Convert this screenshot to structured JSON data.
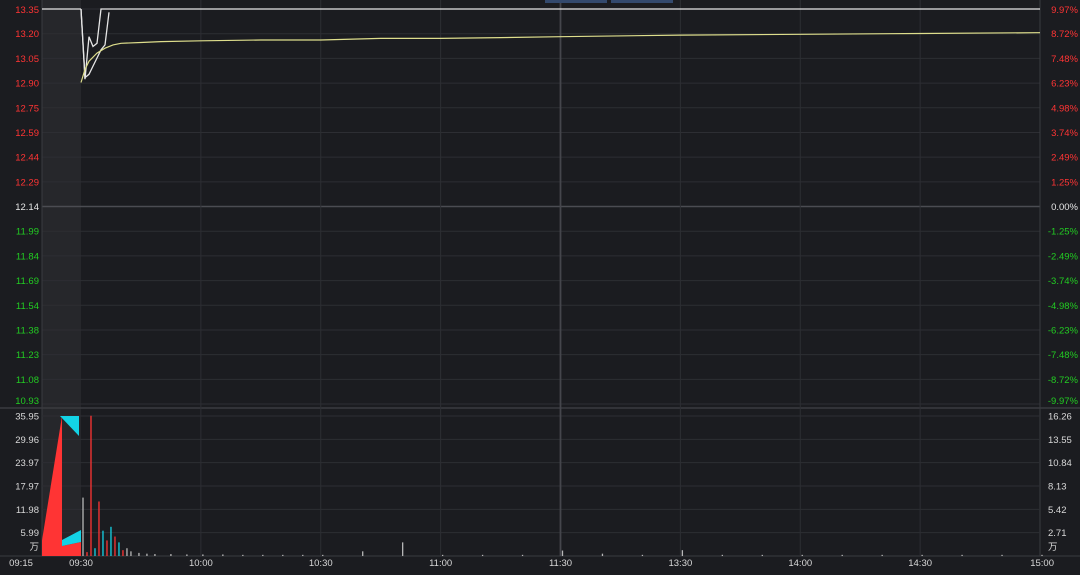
{
  "colors": {
    "background": "#1b1c20",
    "preopen_shade": "#26272b",
    "grid": "#2d2e33",
    "up": "#ff3434",
    "down": "#22cc22",
    "flat": "#e6e6e6",
    "price_line": "#e6e6e6",
    "avg_line": "#dede8c",
    "volume_neutral": "#b8b8b8",
    "auction_buy": "#ff3434",
    "auction_sell": "#13d3e6",
    "tab": "#33496d"
  },
  "price_axis": {
    "left_ticks": [
      "13.35",
      "13.20",
      "13.05",
      "12.90",
      "12.75",
      "12.59",
      "12.44",
      "12.29",
      "12.14",
      "11.99",
      "11.84",
      "11.69",
      "11.54",
      "11.38",
      "11.23",
      "11.08",
      "10.93"
    ],
    "right_ticks": [
      "9.97%",
      "8.72%",
      "7.48%",
      "6.23%",
      "4.98%",
      "3.74%",
      "2.49%",
      "1.25%",
      "0.00%",
      "-1.25%",
      "-2.49%",
      "-3.74%",
      "-4.98%",
      "-6.23%",
      "-7.48%",
      "-8.72%",
      "-9.97%"
    ],
    "prev_close": 12.14,
    "max": 13.35,
    "min": 10.93
  },
  "volume_axis": {
    "left_ticks": [
      "35.95",
      "29.96",
      "23.97",
      "17.97",
      "11.98",
      "5.99"
    ],
    "left_unit": "万",
    "right_ticks": [
      "16.26",
      "13.55",
      "10.84",
      "8.13",
      "5.42",
      "2.71"
    ],
    "right_unit": "万",
    "max": 35.95
  },
  "time_axis": {
    "labels": [
      "09:15",
      "09:30",
      "10:00",
      "10:30",
      "11:00",
      "11:30",
      "13:30",
      "14:00",
      "14:30",
      "15:00"
    ]
  },
  "chart_data": {
    "type": "line",
    "x_unit": "minutes since 09:30 (trading session)",
    "price_series": {
      "x": [
        0,
        1,
        2,
        3,
        4,
        5,
        6,
        7,
        8,
        10,
        20,
        30,
        60,
        90,
        120,
        150,
        180,
        210,
        240
      ],
      "values": [
        13.35,
        12.92,
        13.18,
        13.12,
        13.14,
        13.35,
        13.35,
        13.35,
        13.35,
        13.35,
        13.35,
        13.35,
        13.35,
        13.35,
        13.35,
        13.35,
        13.35,
        13.35,
        13.35
      ]
    },
    "avg_series": {
      "x": [
        0,
        1,
        2,
        4,
        6,
        8,
        10,
        15,
        20,
        30,
        45,
        60,
        75,
        90,
        105,
        120,
        150,
        180,
        210,
        239,
        240
      ],
      "values": [
        12.9,
        12.98,
        13.03,
        13.08,
        13.11,
        13.13,
        13.14,
        13.145,
        13.15,
        13.155,
        13.16,
        13.16,
        13.17,
        13.17,
        13.175,
        13.18,
        13.19,
        13.195,
        13.2,
        13.205,
        13.205
      ]
    },
    "auction_series": {
      "x": [
        0,
        1,
        2,
        3,
        4,
        5,
        6,
        7
      ],
      "values": [
        13.35,
        12.93,
        12.95,
        13.0,
        13.05,
        13.1,
        13.13,
        13.33
      ]
    },
    "volume_bars": {
      "x": [
        0,
        1,
        2,
        3,
        4,
        5,
        6,
        7,
        8,
        9,
        10,
        11,
        12,
        14,
        16,
        18,
        22,
        26,
        30,
        35,
        40,
        45,
        50,
        55,
        60,
        70,
        80,
        90,
        100,
        110,
        120,
        130,
        140,
        150,
        160,
        170,
        180,
        190,
        200,
        210,
        220,
        230,
        240
      ],
      "values": [
        15.0,
        1.0,
        36.0,
        2.0,
        14.0,
        6.5,
        4.0,
        7.5,
        5.0,
        3.5,
        1.5,
        2.0,
        1.2,
        0.8,
        0.6,
        0.5,
        0.5,
        0.4,
        0.4,
        0.4,
        0.3,
        0.3,
        0.3,
        0.3,
        0.3,
        1.2,
        3.5,
        0.3,
        0.3,
        0.3,
        1.4,
        0.6,
        0.3,
        1.5,
        0.3,
        0.3,
        0.3,
        0.3,
        0.3,
        0.3,
        0.3,
        0.3,
        0.3
      ],
      "colors": [
        "neutral",
        "up",
        "up",
        "down",
        "up",
        "down",
        "up",
        "down",
        "up",
        "down",
        "up",
        "neutral",
        "neutral",
        "neutral",
        "neutral",
        "neutral",
        "neutral",
        "neutral",
        "neutral",
        "neutral",
        "neutral",
        "neutral",
        "neutral",
        "neutral",
        "neutral",
        "neutral",
        "neutral",
        "neutral",
        "neutral",
        "neutral",
        "neutral",
        "neutral",
        "neutral",
        "neutral",
        "neutral",
        "neutral",
        "neutral",
        "neutral",
        "neutral",
        "neutral",
        "neutral",
        "neutral",
        "neutral"
      ]
    },
    "ylim": [
      10.93,
      13.35
    ],
    "volume_ylim": [
      0,
      35.95
    ],
    "grid": true
  }
}
